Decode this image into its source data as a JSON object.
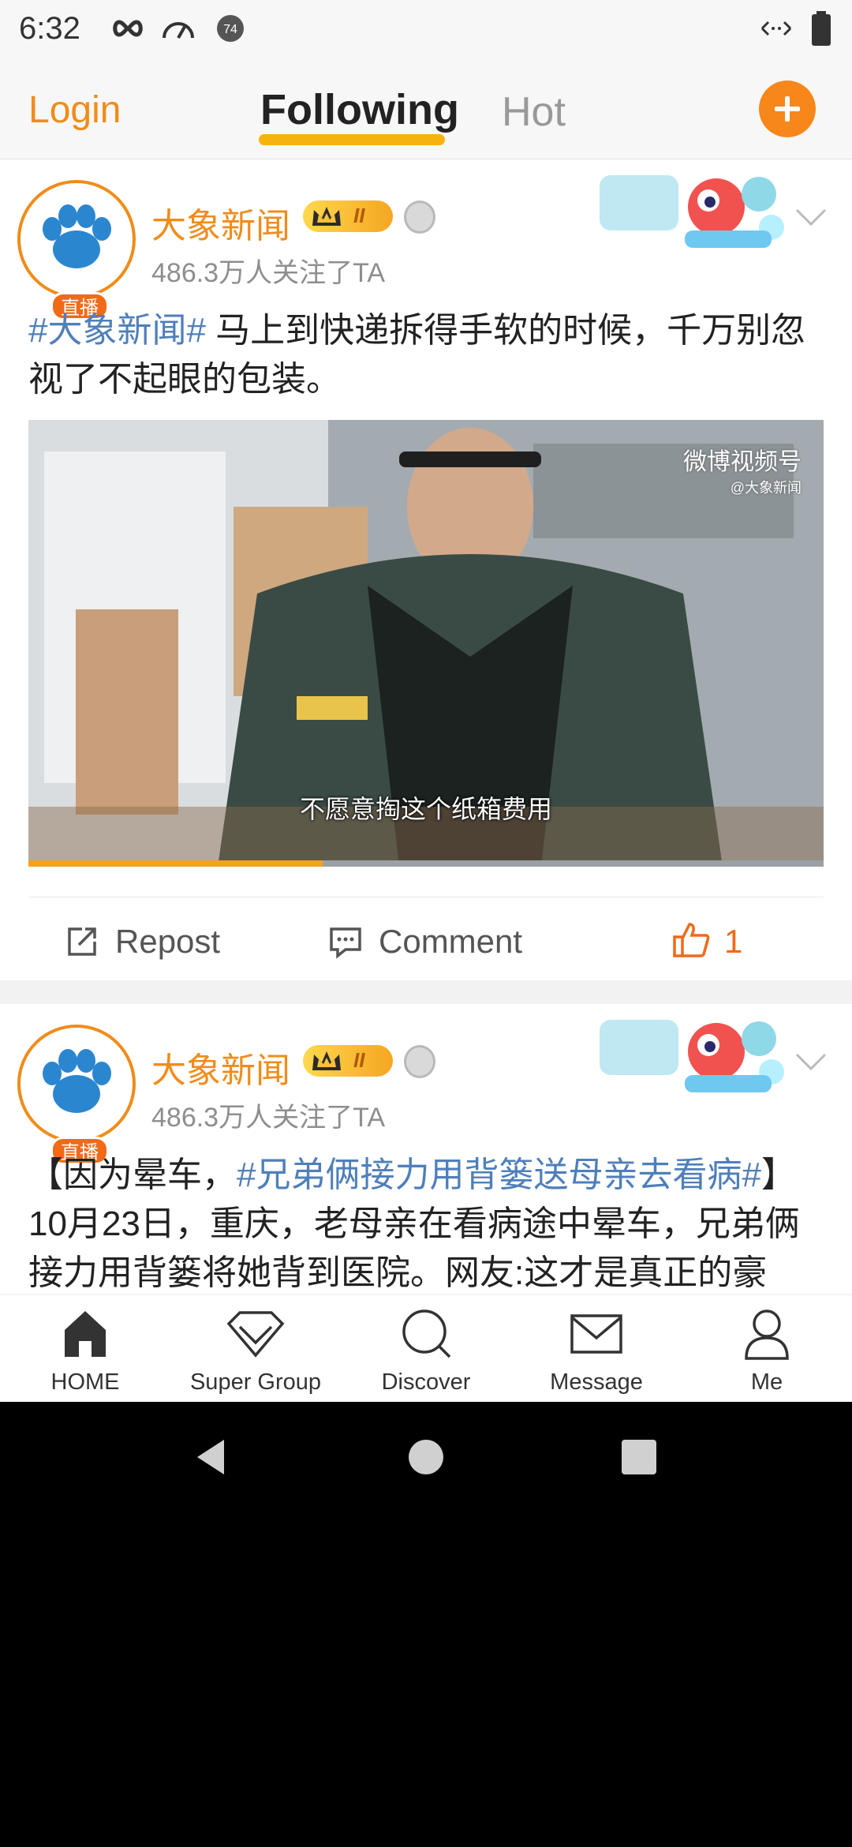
{
  "status_bar": {
    "time": "6:32",
    "icons": [
      "infinity-icon",
      "speedometer-icon",
      "notification-74-icon",
      "data-arrows-icon",
      "battery-icon"
    ],
    "badge_value": "74"
  },
  "top_nav": {
    "login_label": "Login",
    "tabs": [
      {
        "label": "Following",
        "active": true
      },
      {
        "label": "Hot",
        "active": false
      }
    ],
    "accent_color": "#f08c19"
  },
  "posts": [
    {
      "username": "大象新闻",
      "live_badge": "直播",
      "rank_badge": "II",
      "followers": "486.3万人关注了TA",
      "hashtag": "#大象新闻#",
      "text": " 马上到快递拆得手软的时候，千万别忽视了不起眼的包装。",
      "video": {
        "caption": "不愿意掏这个纸箱费用",
        "watermark": "微博视频号",
        "watermark_sub": "@大象新闻",
        "progress": 0.37
      },
      "actions": {
        "repost": "Repost",
        "comment": "Comment",
        "likes": "1"
      }
    },
    {
      "username": "大象新闻",
      "live_badge": "直播",
      "rank_badge": "II",
      "followers": "486.3万人关注了TA",
      "text_prefix": "【因为晕车，",
      "hashtag": "#兄弟俩接力用背篓送母亲去看病#",
      "text_suffix": "】10月23日，重庆，老母亲在看病途中晕车，兄弟俩接力用背篓将她背到医院。网友:这才是真正的豪"
    }
  ],
  "tab_bar": {
    "items": [
      {
        "label": "HOME",
        "icon": "home-icon"
      },
      {
        "label": "Super Group",
        "icon": "diamond-icon"
      },
      {
        "label": "Discover",
        "icon": "search-icon"
      },
      {
        "label": "Message",
        "icon": "envelope-icon"
      },
      {
        "label": "Me",
        "icon": "person-icon"
      }
    ]
  },
  "system_nav": {
    "buttons": [
      "back-icon",
      "home-circle-icon",
      "recents-icon"
    ]
  }
}
